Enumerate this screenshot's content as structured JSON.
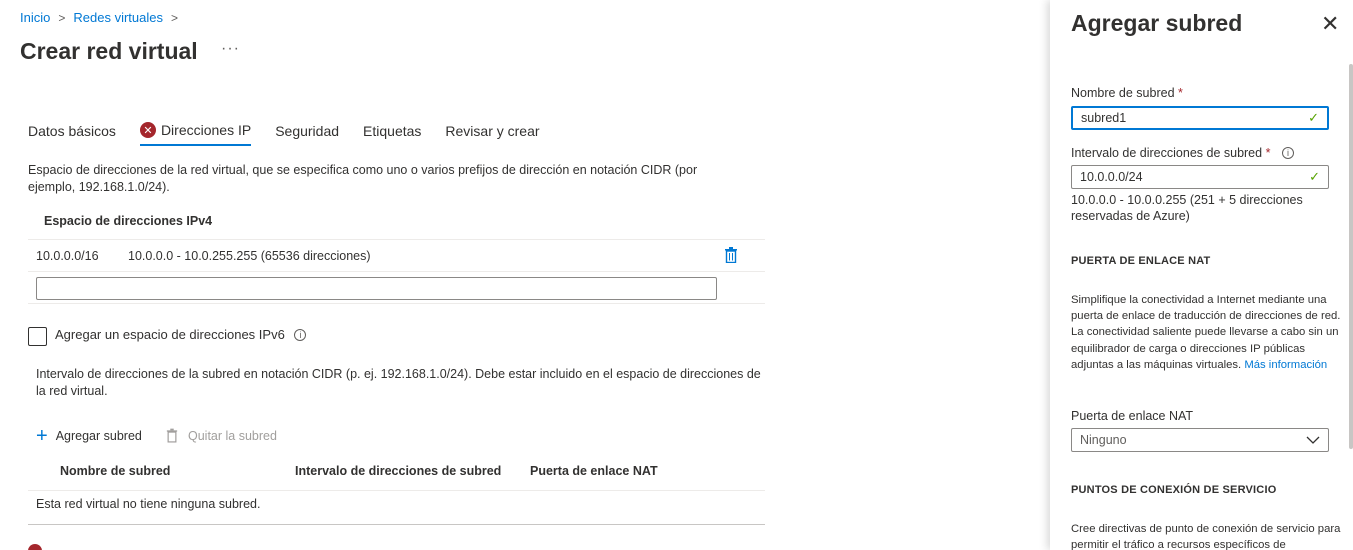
{
  "breadcrumb": {
    "items": [
      "Inicio",
      "Redes virtuales"
    ]
  },
  "page": {
    "title": "Crear red virtual",
    "more": "···"
  },
  "tabs": [
    "Datos básicos",
    "Direcciones IP",
    "Seguridad",
    "Etiquetas",
    "Revisar y crear"
  ],
  "tab_error_icon": "✕",
  "ip": {
    "description": "Espacio de direcciones de la red virtual, que se especifica como uno o varios prefijos de dirección en notación CIDR (por ejemplo, 192.168.1.0/24).",
    "ipv4_header": "Espacio de direcciones IPv4",
    "ipv4_cidr": "10.0.0.0/16",
    "ipv4_range": "10.0.0.0 - 10.0.255.255 (65536 direcciones)",
    "ipv6_label": "Agregar un espacio de direcciones IPv6",
    "subnet_description": "Intervalo de direcciones de la subred en notación CIDR (p. ej. 192.168.1.0/24). Debe estar incluido en el espacio de direcciones de la red virtual.",
    "add_subnet": "Agregar subred",
    "remove_subnet": "Quitar la subred",
    "columns": [
      "Nombre de subred",
      "Intervalo de direcciones de subred",
      "Puerta de enlace NAT"
    ],
    "empty": "Esta red virtual no tiene ninguna subred."
  },
  "panel": {
    "title": "Agregar subred",
    "close": "✕",
    "name_label": "Nombre de subred",
    "name_value": "subred1",
    "range_label": "Intervalo de direcciones de subred",
    "range_value": "10.0.0.0/24",
    "range_hint": "10.0.0.0 - 10.0.0.255 (251 + 5 direcciones reservadas de Azure)",
    "nat_section": "PUERTA DE ENLACE NAT",
    "nat_paragraph": "Simplifique la conectividad a Internet mediante una puerta de enlace de traducción de direcciones de red. La conectividad saliente puede llevarse a cabo sin un equilibrador de carga o direcciones IP públicas adjuntas a las máquinas virtuales.",
    "nat_link": "Más información",
    "nat_label": "Puerta de enlace NAT",
    "nat_value": "Ninguno",
    "endpoints_section": "PUNTOS DE CONEXIÓN DE SERVICIO",
    "endpoints_paragraph": "Cree directivas de punto de conexión de servicio para permitir el tráfico a recursos específicos de"
  },
  "required_mark": "*",
  "info_glyph": "i",
  "check_glyph": "✓",
  "plus_glyph": "+",
  "chevron_glyph": "⌄",
  "colors": {
    "accent": "#0078d4",
    "error": "#a4262c",
    "success": "#57a300"
  }
}
